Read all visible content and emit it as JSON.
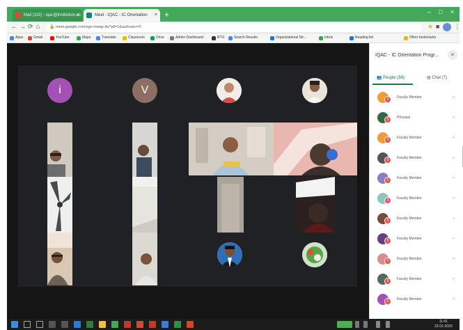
{
  "browser": {
    "tabs": [
      {
        "label": "Mail (115) - iqac@institution.ac",
        "close": "×"
      },
      {
        "label": "Meet - IQAC - IC Orientation",
        "close": "×"
      }
    ],
    "new_tab": "+",
    "window_controls": [
      "–",
      "□",
      "×"
    ],
    "nav": {
      "back": "←",
      "forward": "→",
      "reload": "⟳",
      "home": "⌂"
    },
    "url": "meet.google.com/xgn-mwqy-ifa?pli=1&authuser=0",
    "bookmarks": [
      "Apps",
      "Gmail",
      "YouTube",
      "Maps",
      "Translate",
      "Classroom",
      "Drive",
      "Admin Dashboard",
      "RTO",
      "Search Results",
      "Organizational Str...",
      "Inbox",
      "Reading list",
      "Other bookmarks"
    ],
    "colors": {
      "chrome_green": "#43a85a",
      "active_tab": "#f4f6f4"
    }
  },
  "meet": {
    "participants_grid": [
      {
        "kind": "letter-avatar",
        "letter": "i",
        "color": "#a451b5"
      },
      {
        "kind": "letter-avatar",
        "letter": "V",
        "color": "#8d6e63"
      },
      {
        "kind": "photo-avatar"
      },
      {
        "kind": "photo-avatar"
      },
      {
        "kind": "photo-avatar"
      },
      {
        "kind": "photo-avatar"
      }
    ]
  },
  "panel": {
    "title": "IQAC - IC Orientation Progr...",
    "close": "×",
    "tabs": {
      "people": "People (56)",
      "chat": "Chat (7)"
    },
    "participants": [
      {
        "name": "Faculty Member",
        "color": "#f29b38"
      },
      {
        "name": "Principal",
        "color": "#2f6b3f"
      },
      {
        "name": "Faculty Member",
        "color": "#f29b38"
      },
      {
        "name": "Faculty Member",
        "color": "#555555"
      },
      {
        "name": "Faculty Member",
        "color": "#8e7cc3"
      },
      {
        "name": "Faculty Member",
        "color": "#8ec5c0"
      },
      {
        "name": "Faculty Member",
        "color": "#7a4a3a"
      },
      {
        "name": "Faculty Member",
        "color": "#6a3e7a"
      },
      {
        "name": "Faculty Member",
        "color": "#d98d8d"
      },
      {
        "name": "Faculty Member",
        "color": "#556b5a"
      },
      {
        "name": "Faculty Member",
        "color": "#a451b5"
      }
    ],
    "badge_text": "5",
    "chevron": "⌄"
  },
  "taskbar": {
    "time": "11:41",
    "date": "22-01-2020"
  }
}
